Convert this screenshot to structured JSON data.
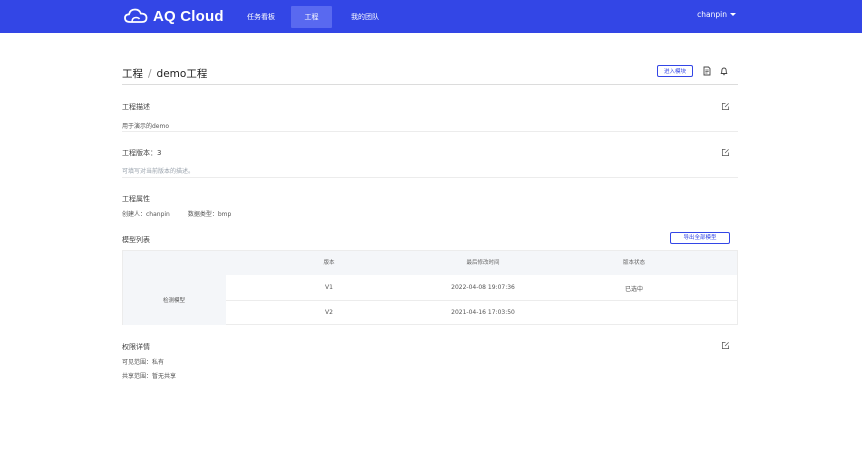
{
  "brand": {
    "name": "AQ Cloud",
    "accent": "#3346e6"
  },
  "nav": {
    "items": [
      {
        "label": "任务看板"
      },
      {
        "label": "工程"
      },
      {
        "label": "我的团队"
      }
    ],
    "active_index": 1
  },
  "user": {
    "name": "chanpin"
  },
  "page": {
    "breadcrumb_root": "工程",
    "breadcrumb_separator": "/",
    "title": "demo工程"
  },
  "actions": {
    "enter_model": "进入模块"
  },
  "description": {
    "title": "工程描述",
    "text": "用于演示的demo"
  },
  "version": {
    "title": "工程版本：3",
    "text": "可填写对当前版本的描述。"
  },
  "attributes": {
    "title": "工程属性",
    "creator": "创建人：chanpin",
    "data_type": "数据类型：bmp"
  },
  "model_list": {
    "title": "模型列表",
    "export_label": "导出全部模型",
    "columns": [
      "版本",
      "最后修改时间",
      "版本状态"
    ],
    "group_label": "检测模型",
    "rows": [
      {
        "version": "V1",
        "modified": "2022-04-08 19:07:36",
        "status": "已选中"
      },
      {
        "version": "V2",
        "modified": "2021-04-16 17:03:50",
        "status": ""
      }
    ]
  },
  "permissions": {
    "title": "权限详情",
    "visibility": "可见范围：私有",
    "sharing": "共享范围：暂无共享"
  }
}
